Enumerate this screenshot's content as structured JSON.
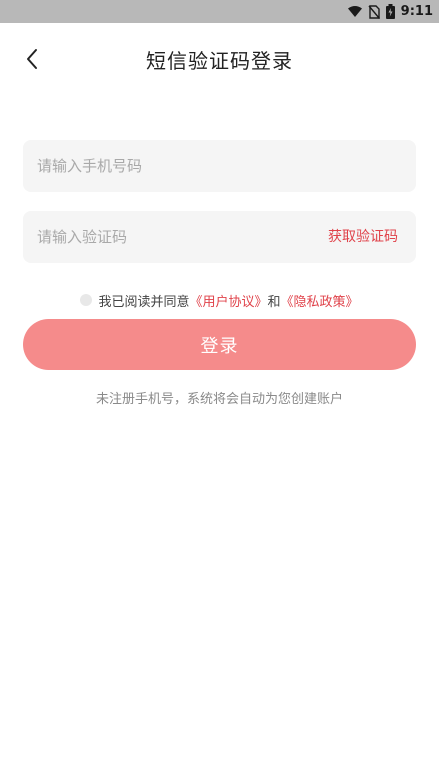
{
  "status": {
    "time": "9:11",
    "icons": [
      "wifi-icon",
      "no-sim-icon",
      "battery-icon"
    ]
  },
  "nav": {
    "back_icon": "back-arrow-icon",
    "title": "短信验证码登录"
  },
  "form": {
    "phone_placeholder": "请输入手机号码",
    "phone_value": "",
    "code_placeholder": "请输入验证码",
    "code_value": "",
    "get_code_label": "获取验证码"
  },
  "agreement": {
    "checked": false,
    "prefix": "我已阅读并同意",
    "user_agreement": "《用户协议》",
    "and": "和",
    "privacy_policy": "《隐私政策》"
  },
  "login": {
    "label": "登录"
  },
  "hint": "未注册手机号，系统将会自动为您创建账户",
  "colors": {
    "accent": "#e0424a",
    "button": "#f58b8b",
    "field_bg": "#f5f5f5",
    "status_bar": "#b8b8b8"
  }
}
